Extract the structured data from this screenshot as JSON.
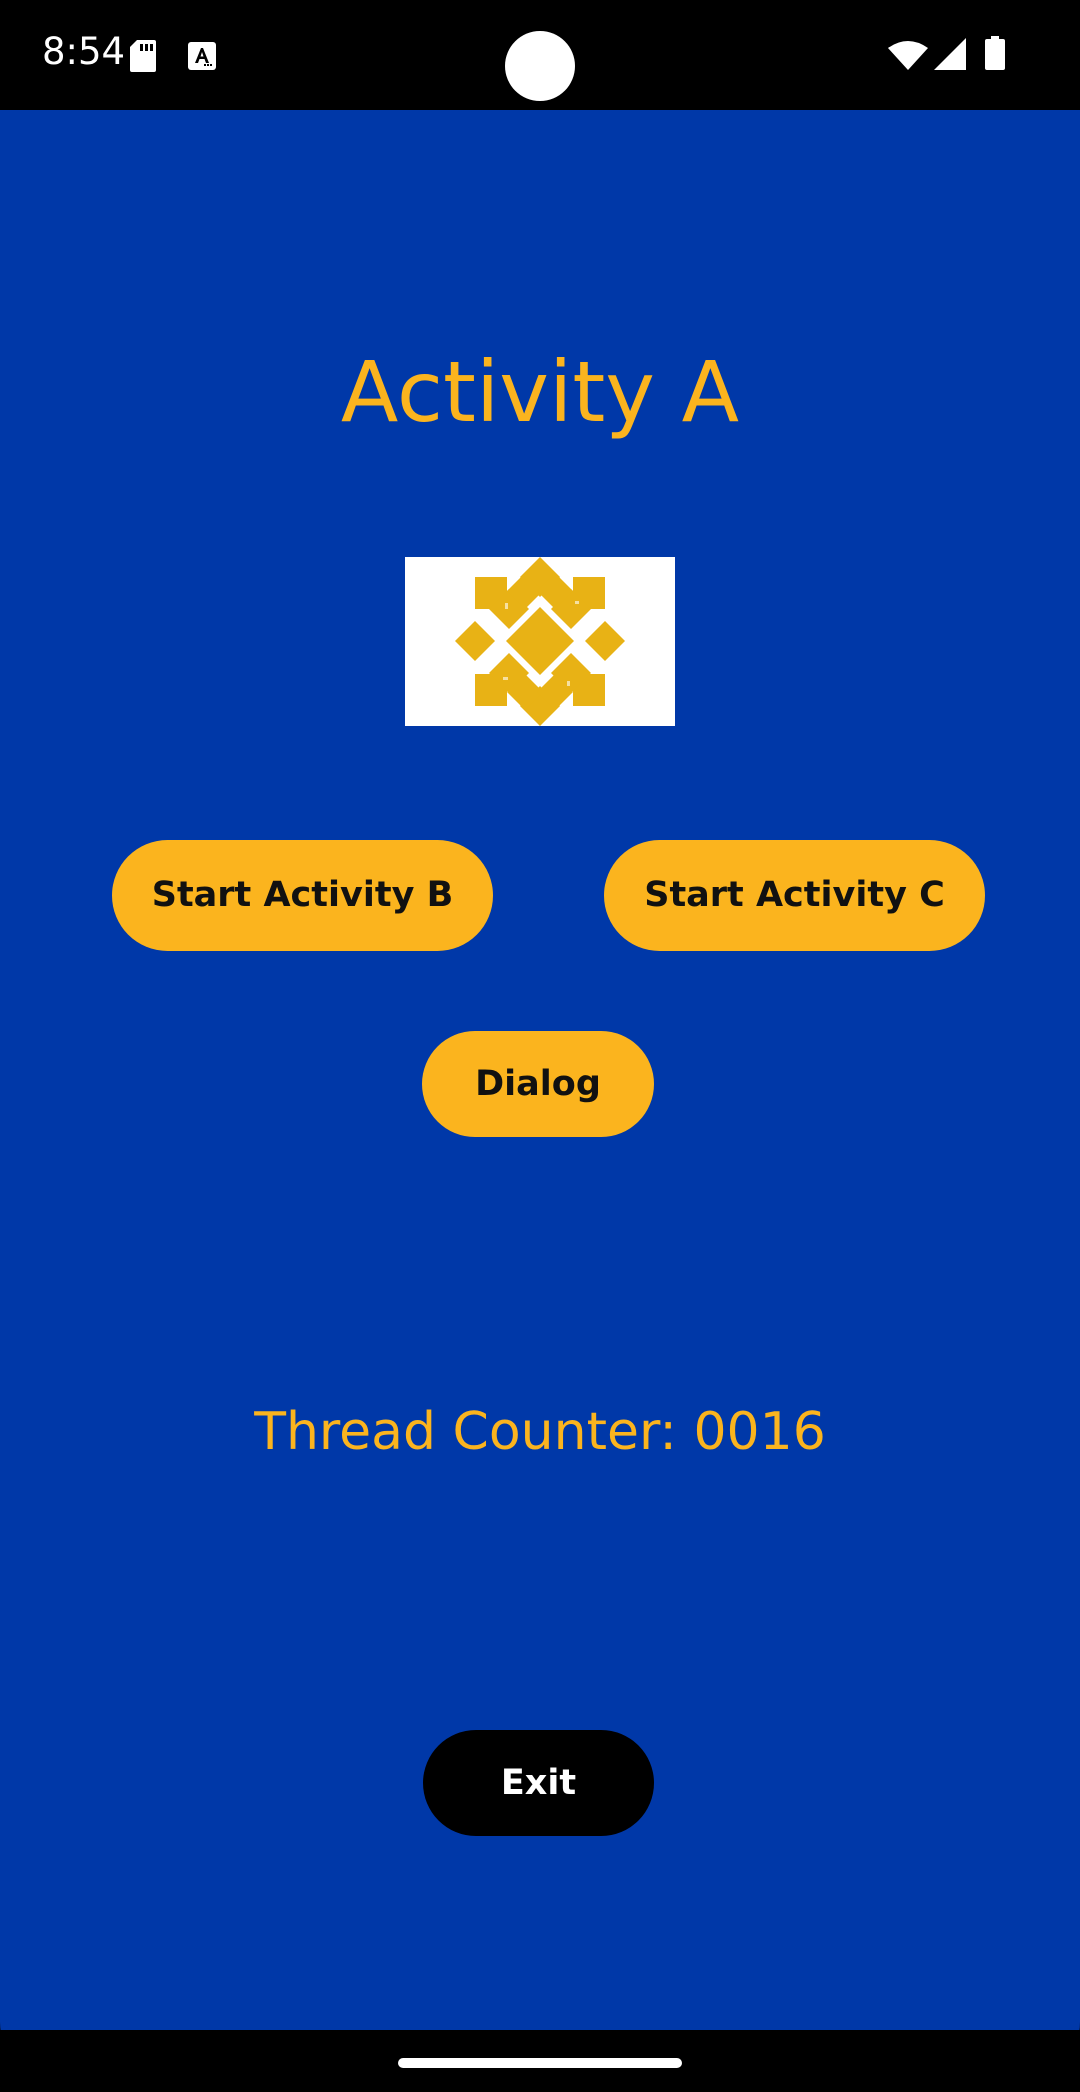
{
  "status_bar": {
    "time": "8:54",
    "icons": [
      "sd-card-icon",
      "text-a-icon",
      "wifi-icon",
      "signal-icon",
      "battery-icon"
    ]
  },
  "app": {
    "title": "Activity A",
    "logo_icon": "diamond-tile-logo",
    "buttons": {
      "start_b": "Start Activity B",
      "start_c": "Start Activity C",
      "dialog": "Dialog",
      "exit": "Exit"
    },
    "counter_text": "Thread Counter: 0016"
  },
  "colors": {
    "background": "#0038a8",
    "accent": "#fbb41e",
    "exit_button": "#000000",
    "logo": "#e8b215"
  }
}
